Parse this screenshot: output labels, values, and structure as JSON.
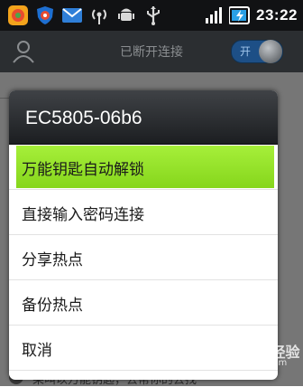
{
  "status_bar": {
    "time": "23:22",
    "icons": [
      "app-icon",
      "shield-icon",
      "mail-icon",
      "wifi-hotspot-icon",
      "android-debug-icon",
      "usb-icon",
      "signal-icon",
      "battery-charging-icon"
    ]
  },
  "app_header": {
    "title": "已断开连接",
    "toggle_label": "开"
  },
  "dialog": {
    "title": "EC5805-06b6",
    "menu_items": [
      {
        "label": "万能钥匙自动解锁",
        "selected": true
      },
      {
        "label": "直接输入密码连接",
        "selected": false
      },
      {
        "label": "分享热点",
        "selected": false
      },
      {
        "label": "备份热点",
        "selected": false
      },
      {
        "label": "取消",
        "selected": false
      }
    ]
  },
  "background": {
    "bottom_text": "果叫以万能钥匙，去帮你的去找"
  },
  "watermark": {
    "line1": "Bai du 经验",
    "line2": "jingyan.baidu.com"
  },
  "colors": {
    "highlight": "#95e22a",
    "header": "#2b2e31",
    "toggle": "#1d4f86"
  }
}
